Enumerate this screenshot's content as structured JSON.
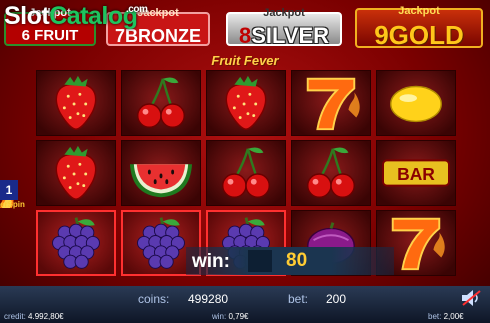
{
  "brand": {
    "slot": "Slot",
    "catalog": "Catalog",
    "com": ".com"
  },
  "jackpots": {
    "fruit": {
      "title": "Jackpot",
      "number": "6",
      "name": "FRUIT"
    },
    "bronze": {
      "title": "Jackpot",
      "number": "7",
      "name": "BRONZE"
    },
    "silver": {
      "title": "Jackpot",
      "number": "8",
      "name": "SILVER"
    },
    "gold": {
      "title": "Jackpot",
      "number": "9",
      "name": "GOLD"
    }
  },
  "game_title": "Fruit Fever",
  "reels": [
    [
      "strawberry",
      "strawberry",
      "grapes"
    ],
    [
      "cherry",
      "watermelon",
      "grapes"
    ],
    [
      "strawberry",
      "cherry",
      "grapes"
    ],
    [
      "seven",
      "cherry",
      "plum"
    ],
    [
      "lemon",
      "bar",
      "seven"
    ]
  ],
  "winning_row": 2,
  "side": {
    "number": "1",
    "label": "erSpin"
  },
  "win": {
    "label": "win:",
    "value": "80"
  },
  "footer": {
    "coins_label": "coins:",
    "coins_value": "499280",
    "bet_label": "bet:",
    "bet_value": "200",
    "credit_label": "credit:",
    "credit_value": "4.992,80€",
    "win_label": "win:",
    "win_value": "0,79€",
    "bet2_label": "bet:",
    "bet2_value": "2,00€"
  },
  "colors": {
    "background": "#7a0000",
    "accent_gold": "#ffc61a",
    "win_border": "#ff3030",
    "panel": "#1b3550"
  }
}
